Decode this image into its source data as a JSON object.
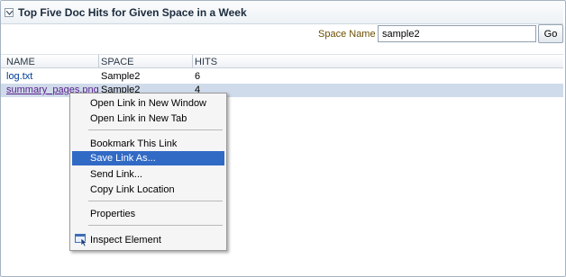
{
  "panel": {
    "title": "Top Five Doc Hits for Given Space in a Week"
  },
  "search": {
    "label": "Space Name",
    "value": "sample2",
    "go_label": "Go"
  },
  "table": {
    "columns": [
      "NAME",
      "SPACE",
      "HITS"
    ],
    "rows": [
      {
        "name": "log.txt",
        "space": "Sample2",
        "hits": "6"
      },
      {
        "name": "summary_pages.png",
        "space": "Sample2",
        "hits": "4"
      }
    ]
  },
  "context_menu": {
    "items": [
      "Open Link in New Window",
      "Open Link in New Tab",
      "Bookmark This Link",
      "Save Link As...",
      "Send Link...",
      "Copy Link Location",
      "Properties",
      "Inspect Element"
    ],
    "highlighted": "Save Link As...",
    "highlight_color": "#316ac5"
  }
}
